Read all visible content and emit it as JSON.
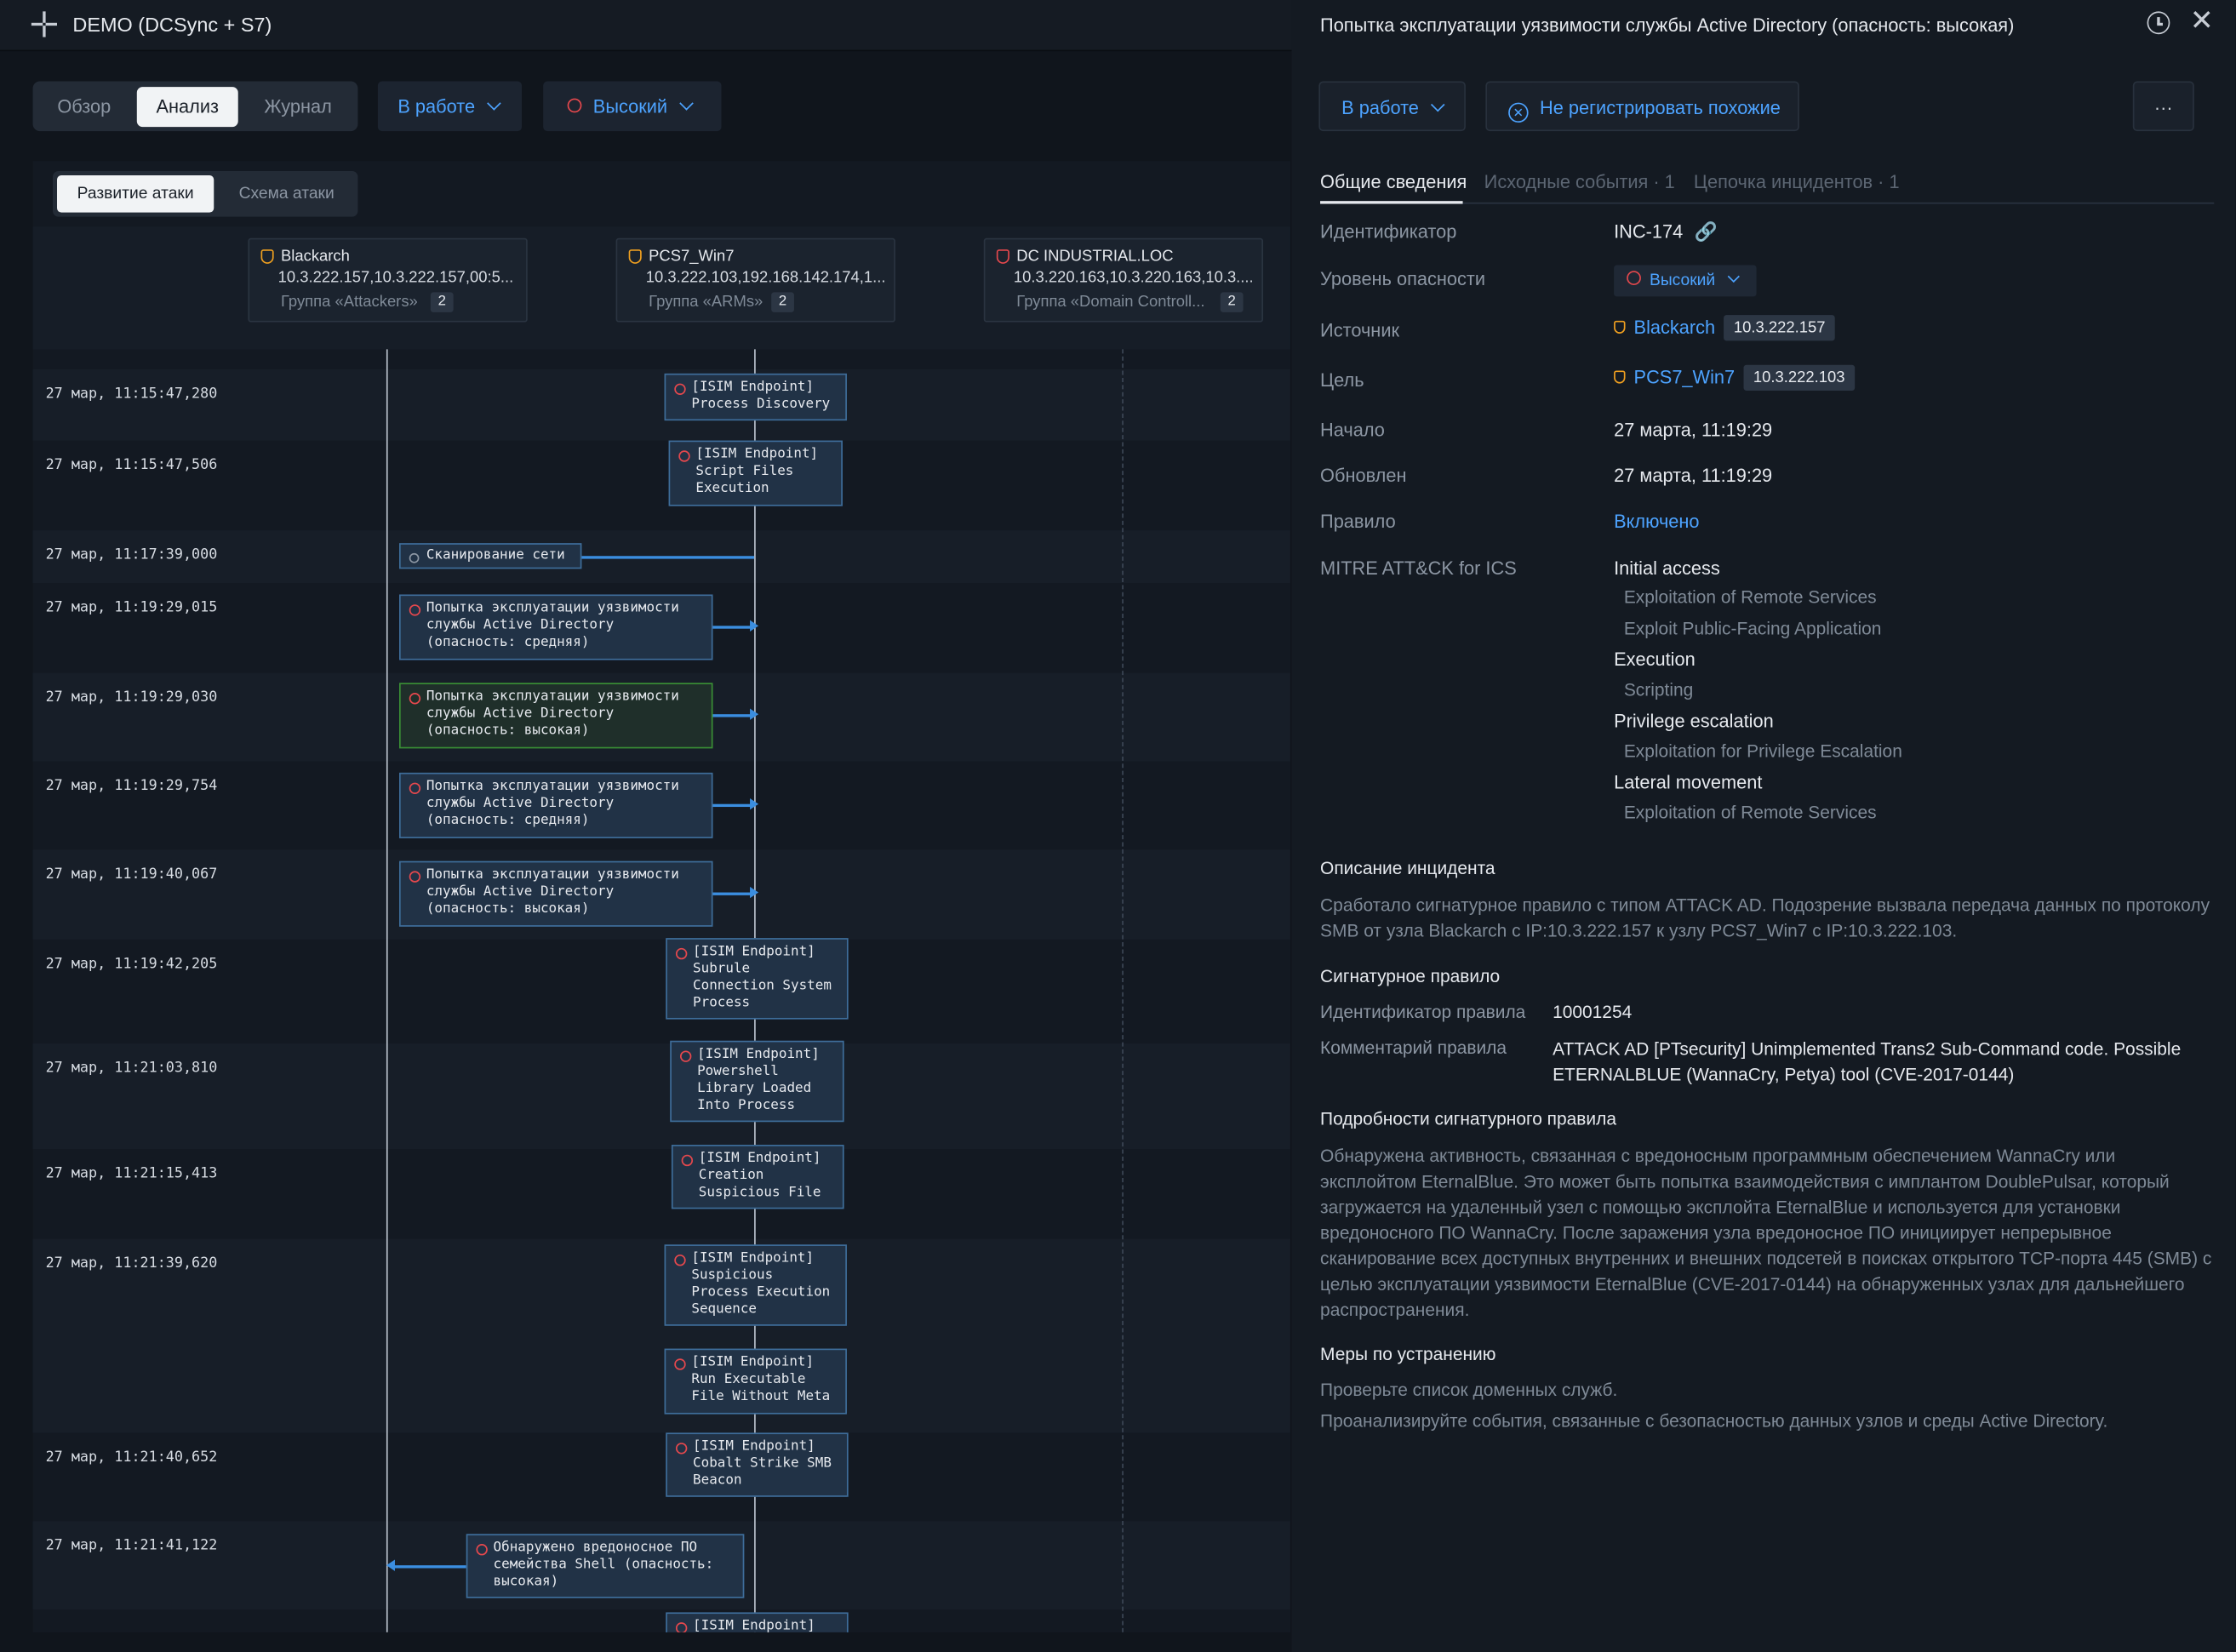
{
  "app": {
    "title": "DEMO (DCSync + S7)"
  },
  "nav": {
    "tabs": [
      {
        "label": "Обзор"
      },
      {
        "label": "Анализ"
      },
      {
        "label": "Журнал"
      }
    ],
    "status_dropdown": "В работе",
    "severity_dropdown": "Высокий"
  },
  "graph": {
    "subtabs": [
      {
        "label": "Развитие атаки"
      },
      {
        "label": "Схема атаки"
      }
    ],
    "hosts": [
      {
        "name": "Blackarch",
        "ips": "10.3.222.157,10.3.222.157,00:5...",
        "group": "Группа «Attackers»",
        "count": "2"
      },
      {
        "name": "PCS7_Win7",
        "ips": "10.3.222.103,192.168.142.174,1...",
        "group": "Группа «ARMs»",
        "count": "2"
      },
      {
        "name": "DC INDUSTRIAL.LOC",
        "ips": "10.3.220.163,10.3.220.163,10.3....",
        "group": "Группа «Domain Controll...",
        "count": "2"
      }
    ],
    "rows": [
      {
        "time": "27 мар, 11:15:47,280"
      },
      {
        "time": "27 мар, 11:15:47,506"
      },
      {
        "time": "27 мар, 11:17:39,000"
      },
      {
        "time": "27 мар, 11:19:29,015"
      },
      {
        "time": "27 мар, 11:19:29,030"
      },
      {
        "time": "27 мар, 11:19:29,754"
      },
      {
        "time": "27 мар, 11:19:40,067"
      },
      {
        "time": "27 мар, 11:19:42,205"
      },
      {
        "time": "27 мар, 11:21:03,810"
      },
      {
        "time": "27 мар, 11:21:15,413"
      },
      {
        "time": "27 мар, 11:21:39,620"
      },
      {
        "time": "27 мар, 11:21:40,652"
      },
      {
        "time": "27 мар, 11:21:41,122"
      }
    ],
    "events": [
      {
        "text": "[ISIM Endpoint]\nProcess Discovery"
      },
      {
        "text": "[ISIM Endpoint]\nScript Files\nExecution"
      },
      {
        "text": "Сканирование сети"
      },
      {
        "text": "Попытка эксплуатации уязвимости\nслужбы Active Directory\n(опасность: средняя)"
      },
      {
        "text": "Попытка эксплуатации уязвимости\nслужбы Active Directory\n(опасность: высокая)"
      },
      {
        "text": "Попытка эксплуатации уязвимости\nслужбы Active Directory\n(опасность: средняя)"
      },
      {
        "text": "Попытка эксплуатации уязвимости\nслужбы Active Directory\n(опасность: высокая)"
      },
      {
        "text": "[ISIM Endpoint]\nSubrule\nConnection System\nProcess"
      },
      {
        "text": "[ISIM Endpoint]\nPowershell\nLibrary Loaded\nInto Process"
      },
      {
        "text": "[ISIM Endpoint]\nCreation\nSuspicious File"
      },
      {
        "text": "[ISIM Endpoint]\nSuspicious\nProcess Execution\nSequence"
      },
      {
        "text": "[ISIM Endpoint]\nRun Executable\nFile Without Meta"
      },
      {
        "text": "[ISIM Endpoint]\nCobalt Strike SMB\nBeacon"
      },
      {
        "text": "Обнаружено вредоносное ПО\nсемейства Shell (опасность:\nвысокая)"
      },
      {
        "text": "[ISIM Endpoint]"
      }
    ]
  },
  "detail": {
    "title": "Попытка эксплуатации уязвимости службы Active Directory (опасность: высокая)",
    "status": "В работе",
    "ignore_similar": "Не регистрировать похожие",
    "more": "···",
    "tabs": [
      {
        "label": "Общие сведения"
      },
      {
        "label": "Исходные события · 1"
      },
      {
        "label": "Цепочка инцидентов · 1"
      }
    ],
    "fields": {
      "id_label": "Идентификатор",
      "id_value": "INC-174",
      "severity_label": "Уровень опасности",
      "severity_value": "Высокий",
      "source_label": "Источник",
      "source_name": "Blackarch",
      "source_ip": "10.3.222.157",
      "target_label": "Цель",
      "target_name": "PCS7_Win7",
      "target_ip": "10.3.222.103",
      "start_label": "Начало",
      "start_value": "27 марта, 11:19:29",
      "updated_label": "Обновлен",
      "updated_value": "27 марта, 11:19:29",
      "rule_label": "Правило",
      "rule_value": "Включено",
      "mitre_label": "MITRE ATT&CK for ICS"
    },
    "mitre": [
      {
        "tactic": "Initial access",
        "techniques": [
          "Exploitation of Remote Services",
          "Exploit Public-Facing Application"
        ]
      },
      {
        "tactic": "Execution",
        "techniques": [
          "Scripting"
        ]
      },
      {
        "tactic": "Privilege escalation",
        "techniques": [
          "Exploitation for Privilege Escalation"
        ]
      },
      {
        "tactic": "Lateral movement",
        "techniques": [
          "Exploitation of Remote Services"
        ]
      }
    ],
    "description_title": "Описание инцидента",
    "description": "Сработало сигнатурное правило с типом ATTACK AD. Подозрение вызвала передача данных по протоколу SMB от узла Blackarch с IP:10.3.222.157 к узлу PCS7_Win7 с IP:10.3.222.103.",
    "signature_title": "Сигнатурное правило",
    "rule_id_label": "Идентификатор правила",
    "rule_id_value": "10001254",
    "rule_comment_label": "Комментарий правила",
    "rule_comment_value": "ATTACK AD [PTsecurity] Unimplemented Trans2 Sub-Command code. Possible ETERNALBLUE (WannaCry, Petya) tool (CVE-2017-0144)",
    "sig_details_title": "Подробности сигнатурного правила",
    "sig_details": "Обнаружена активность, связанная с вредоносным программным обеспечением WannaCry или эксплойтом EternalBlue. Это может быть попытка взаимодействия с имплантом DoublePulsar, который загружается на удаленный узел с помощью эксплойта EternalBlue и используется для установки вредоносного ПО WannaCry. После заражения узла вредоносное ПО инициирует непрерывное сканирование всех доступных внутренних и внешних подсетей в поисках открытого TCP-порта 445 (SMB) с целью эксплуатации уязвимости EternalBlue (CVE-2017-0144) на обнаруженных узлах для дальнейшего распространения.",
    "remediation_title": "Меры по устранению",
    "remediation": [
      "Проверьте список доменных служб.",
      "Проанализируйте события, связанные с безопасностью данных узлов и среды Active Directory."
    ]
  },
  "colors": {
    "accent": "#4da3ff",
    "danger": "#e5484d",
    "source_shield": "#f0a020",
    "bg": "#0f141b"
  }
}
